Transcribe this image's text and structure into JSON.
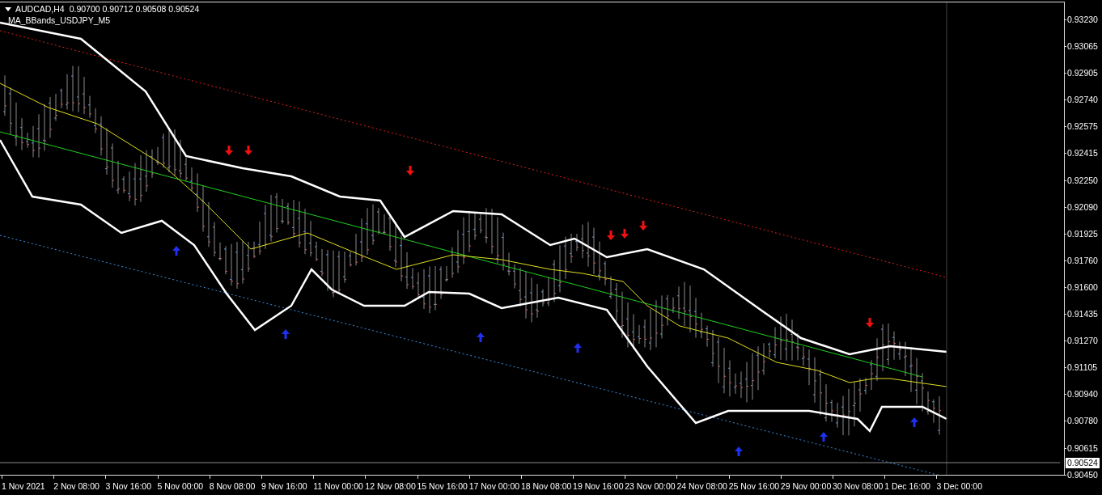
{
  "chart_header": {
    "symbol": "AUDCAD,H4",
    "prices": "0.90700 0.90712 0.90508 0.90524",
    "indicator": "MA_BBands_USDJPY_M5"
  },
  "price_axis": {
    "labels": [
      "0.93230",
      "0.93065",
      "0.92905",
      "0.92740",
      "0.92575",
      "0.92415",
      "0.92250",
      "0.92090",
      "0.91925",
      "0.91760",
      "0.91600",
      "0.91435",
      "0.91270",
      "0.91105",
      "0.90940",
      "0.90780",
      "0.90615",
      "0.90450"
    ],
    "current_price": "0.90524"
  },
  "time_axis": {
    "labels": [
      "1 Nov 2021",
      "2 Nov 08:00",
      "3 Nov 16:00",
      "5 Nov 00:00",
      "8 Nov 08:00",
      "9 Nov 16:00",
      "11 Nov 00:00",
      "12 Nov 08:00",
      "15 Nov 16:00",
      "17 Nov 00:00",
      "18 Nov 08:00",
      "19 Nov 16:00",
      "23 Nov 00:00",
      "24 Nov 08:00",
      "25 Nov 16:00",
      "29 Nov 00:00",
      "30 Nov 08:00",
      "1 Dec 16:00",
      "3 Dec 00:00"
    ]
  }
}
